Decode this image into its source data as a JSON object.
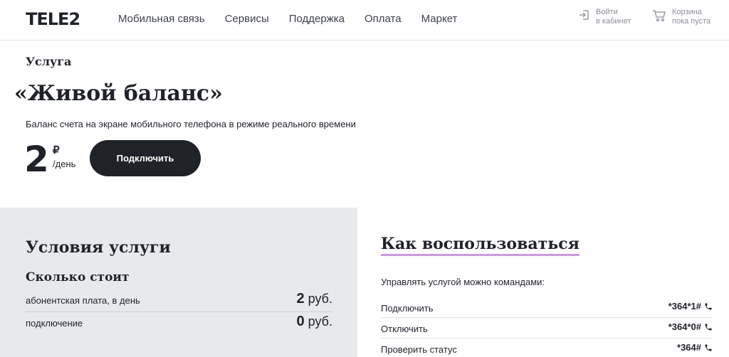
{
  "header": {
    "logo": "TELE2",
    "nav": [
      "Мобильная связь",
      "Сервисы",
      "Поддержка",
      "Оплата",
      "Маркет"
    ],
    "login": {
      "line1": "Войти",
      "line2": "в кабинет",
      "icon": "login-icon"
    },
    "cart": {
      "line1": "Корзина",
      "line2": "пока пуста",
      "icon": "cart-icon"
    }
  },
  "hero": {
    "kicker": "Услуга",
    "title": "«Живой баланс»",
    "subtitle": "Баланс счета на экране мобильного телефона в режиме реального времени",
    "price": "2",
    "currency": "₽",
    "period": "/день",
    "button": "Подключить"
  },
  "conditions": {
    "title": "Условия услуги",
    "subtitle": "Сколько стоит",
    "rows": [
      {
        "label": "абонентская плата, в день",
        "amount": "2",
        "unit": "руб."
      },
      {
        "label": "подключение",
        "amount": "0",
        "unit": "руб."
      }
    ]
  },
  "howto": {
    "title": "Как воспользоваться",
    "intro": "Управлять услугой можно командами:",
    "commands": [
      {
        "label": "Подключить",
        "code": "*364*1#"
      },
      {
        "label": "Отключить",
        "code": "*364*0#"
      },
      {
        "label": "Проверить статус",
        "code": "*364#"
      }
    ],
    "icon": "phone-icon"
  },
  "colors": {
    "dark": "#1f2229",
    "panel": "#e8e9ed",
    "accent_underline": "#c99be0"
  }
}
